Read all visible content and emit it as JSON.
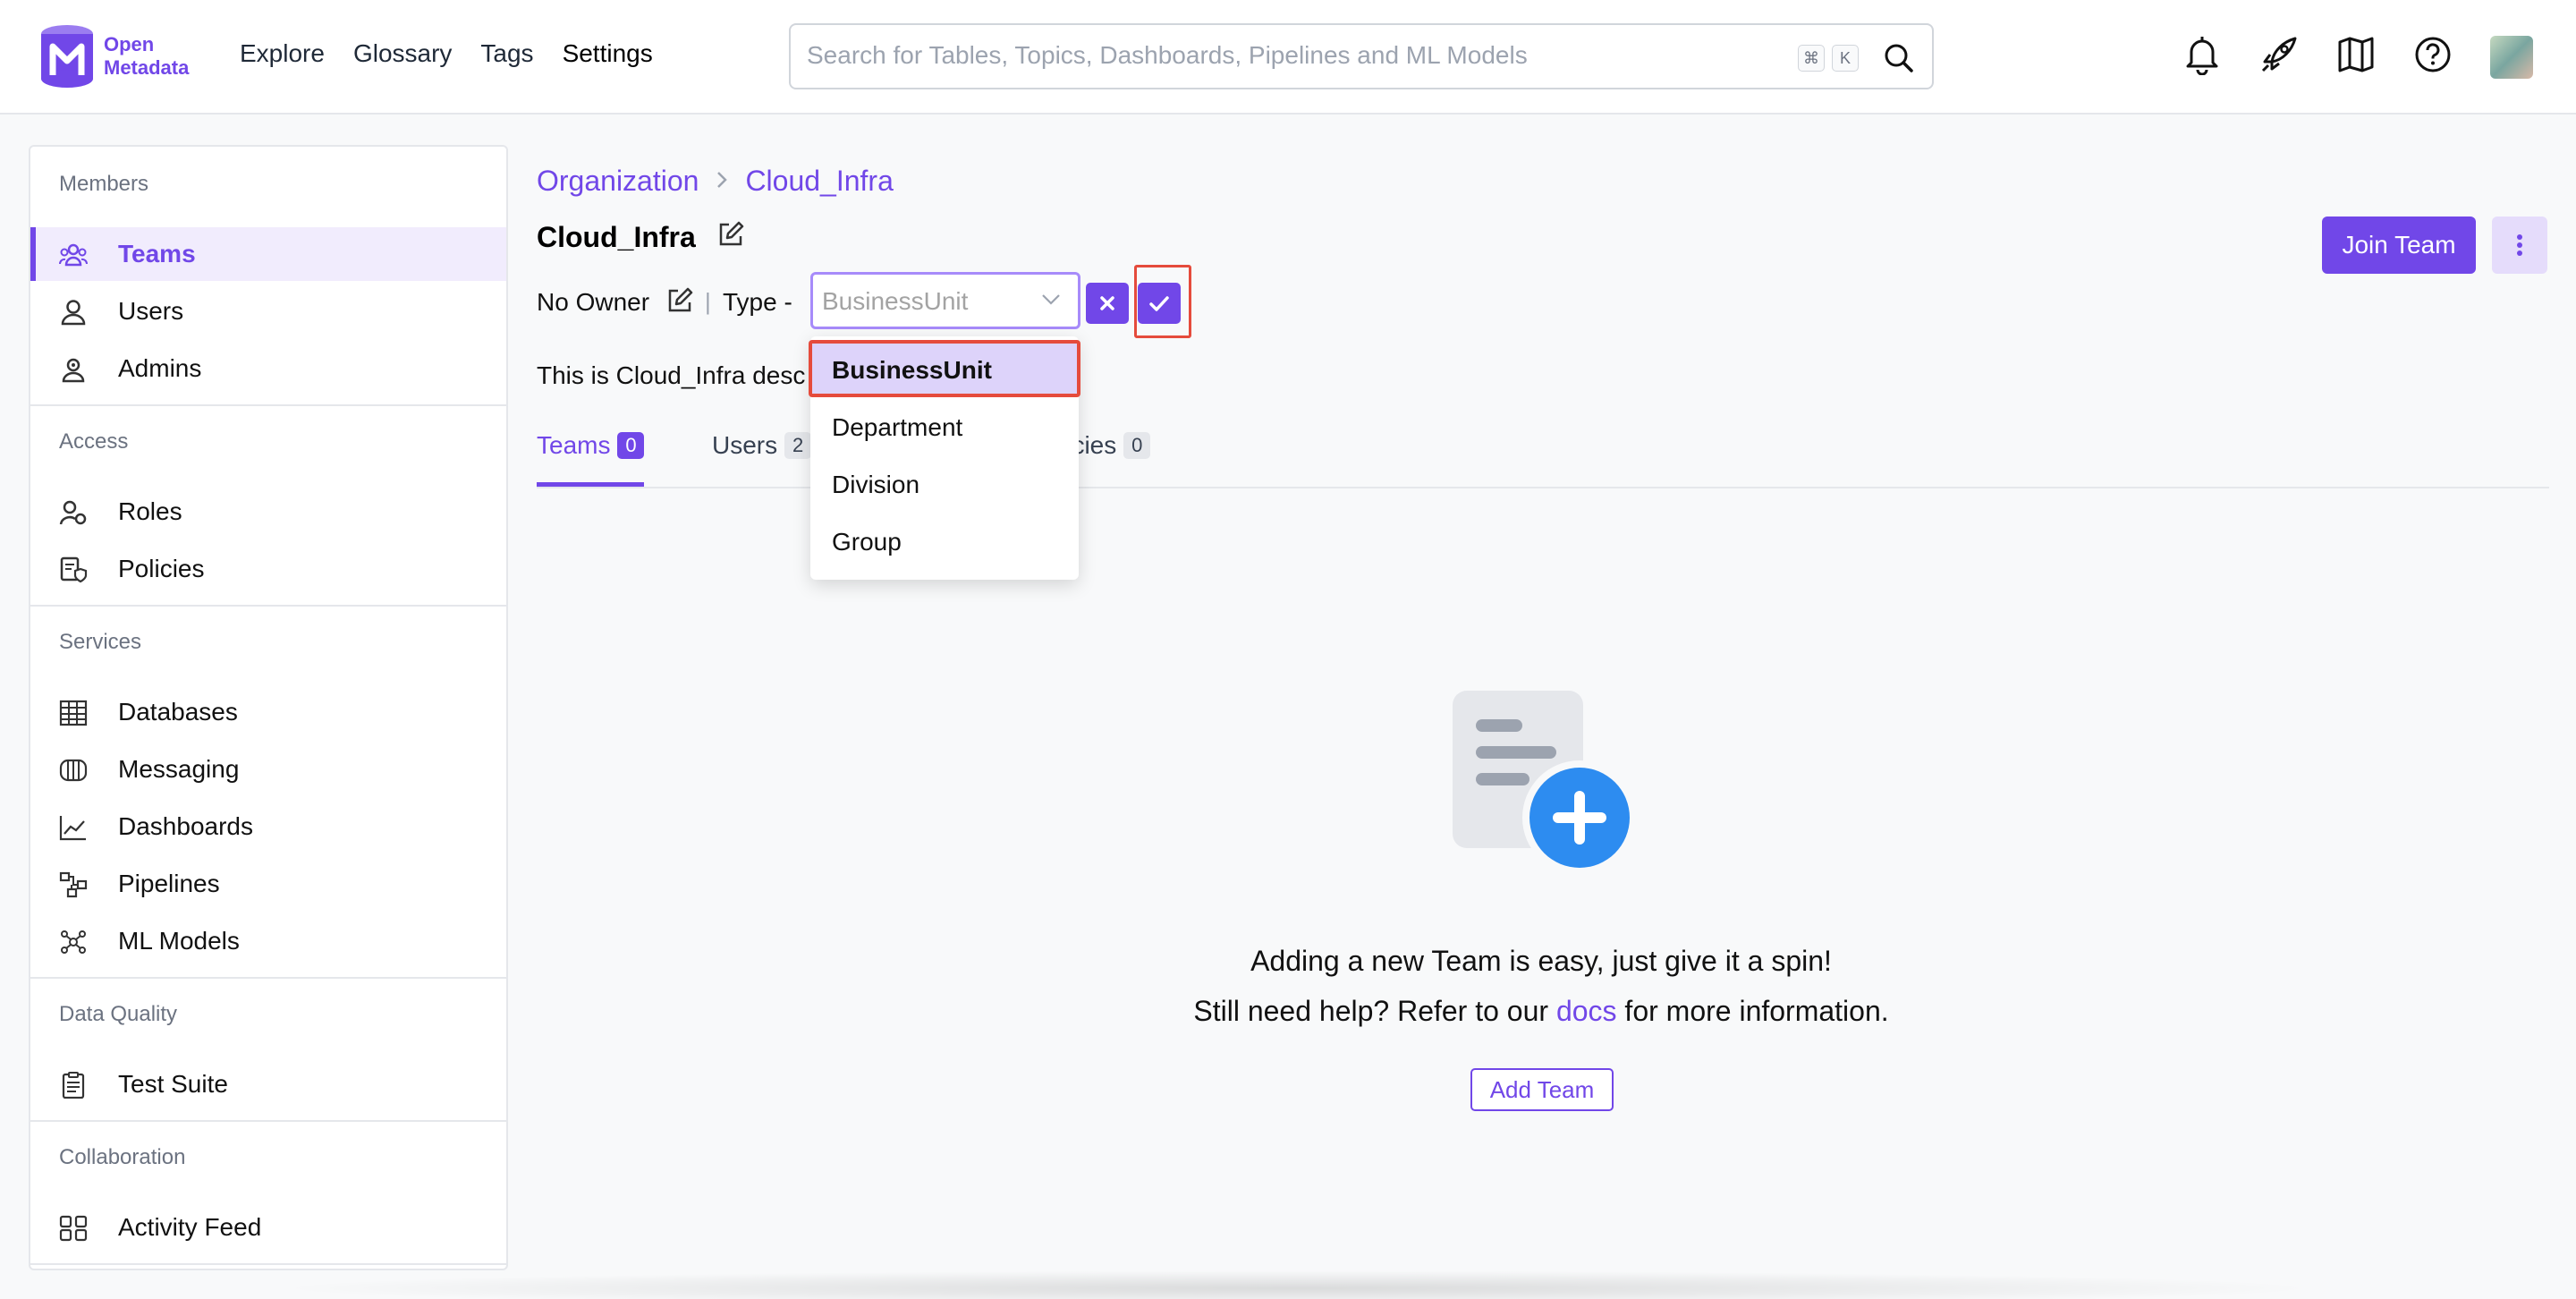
{
  "logo": {
    "line1": "Open",
    "line2": "Metadata"
  },
  "nav": [
    "Explore",
    "Glossary",
    "Tags",
    "Settings"
  ],
  "search": {
    "placeholder": "Search for Tables, Topics, Dashboards, Pipelines and ML Models",
    "kbd1": "⌘",
    "kbd2": "K"
  },
  "sidebar": {
    "sections": {
      "members": "Members",
      "access": "Access",
      "services": "Services",
      "data_quality": "Data Quality",
      "collaboration": "Collaboration"
    },
    "items": {
      "teams": "Teams",
      "users": "Users",
      "admins": "Admins",
      "roles": "Roles",
      "policies": "Policies",
      "databases": "Databases",
      "messaging": "Messaging",
      "dashboards": "Dashboards",
      "pipelines": "Pipelines",
      "ml_models": "ML Models",
      "test_suite": "Test Suite",
      "activity_feed": "Activity Feed"
    }
  },
  "breadcrumb": {
    "root": "Organization",
    "current": "Cloud_Infra"
  },
  "team": {
    "name": "Cloud_Infra",
    "owner": "No Owner",
    "type_label": "Type -",
    "type_value": "BusinessUnit",
    "description": "This is Cloud_Infra descr",
    "join_label": "Join Team"
  },
  "dropdown": {
    "options": [
      "BusinessUnit",
      "Department",
      "Division",
      "Group"
    ],
    "selected": "BusinessUnit"
  },
  "tabs": [
    {
      "label": "Teams",
      "count": "0"
    },
    {
      "label": "Users",
      "count": "2"
    },
    {
      "label": "licies",
      "count": "0"
    }
  ],
  "empty": {
    "line1": "Adding a new Team is easy, just give it a spin!",
    "line2_pre": "Still need help? Refer to our ",
    "line2_link": "docs",
    "line2_post": " for more information.",
    "button": "Add Team"
  },
  "colors": {
    "accent": "#7147e8",
    "highlight": "#e54b3c",
    "selected_bg": "#ddd3fa"
  }
}
